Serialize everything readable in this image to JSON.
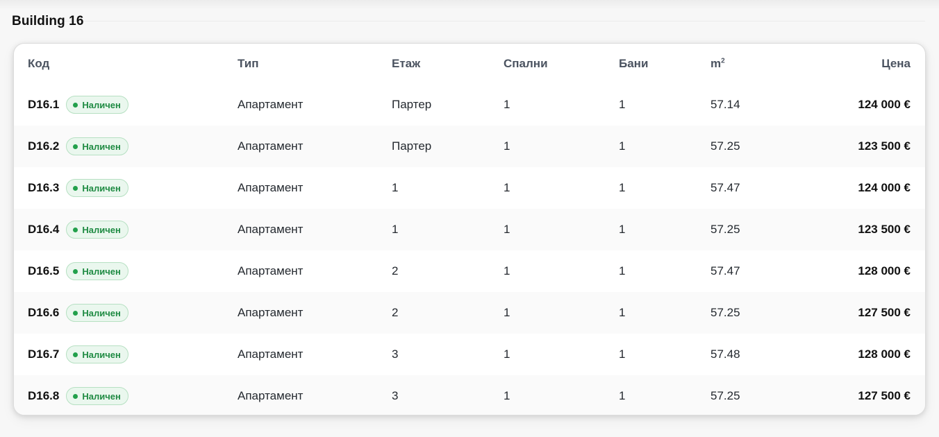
{
  "building": {
    "title": "Building 16"
  },
  "table": {
    "headers": {
      "code": "Код",
      "type": "Тип",
      "floor": "Етаж",
      "bedrooms": "Спални",
      "bathrooms": "Бани",
      "area_base": "m",
      "area_sup": "2",
      "price": "Цена"
    },
    "rows": [
      {
        "code": "D16.1",
        "status": "Наличен",
        "type": "Апартамент",
        "floor": "Партер",
        "bedrooms": "1",
        "bathrooms": "1",
        "area": "57.14",
        "price": "124 000 €"
      },
      {
        "code": "D16.2",
        "status": "Наличен",
        "type": "Апартамент",
        "floor": "Партер",
        "bedrooms": "1",
        "bathrooms": "1",
        "area": "57.25",
        "price": "123 500 €"
      },
      {
        "code": "D16.3",
        "status": "Наличен",
        "type": "Апартамент",
        "floor": "1",
        "bedrooms": "1",
        "bathrooms": "1",
        "area": "57.47",
        "price": "124 000 €"
      },
      {
        "code": "D16.4",
        "status": "Наличен",
        "type": "Апартамент",
        "floor": "1",
        "bedrooms": "1",
        "bathrooms": "1",
        "area": "57.25",
        "price": "123 500 €"
      },
      {
        "code": "D16.5",
        "status": "Наличен",
        "type": "Апартамент",
        "floor": "2",
        "bedrooms": "1",
        "bathrooms": "1",
        "area": "57.47",
        "price": "128 000 €"
      },
      {
        "code": "D16.6",
        "status": "Наличен",
        "type": "Апартамент",
        "floor": "2",
        "bedrooms": "1",
        "bathrooms": "1",
        "area": "57.25",
        "price": "127 500 €"
      },
      {
        "code": "D16.7",
        "status": "Наличен",
        "type": "Апартамент",
        "floor": "3",
        "bedrooms": "1",
        "bathrooms": "1",
        "area": "57.48",
        "price": "128 000 €"
      },
      {
        "code": "D16.8",
        "status": "Наличен",
        "type": "Апартамент",
        "floor": "3",
        "bedrooms": "1",
        "bathrooms": "1",
        "area": "57.25",
        "price": "127 500 €"
      }
    ]
  },
  "colors": {
    "status_available": "#22a04b",
    "status_available_bg": "#eaf7ee"
  }
}
